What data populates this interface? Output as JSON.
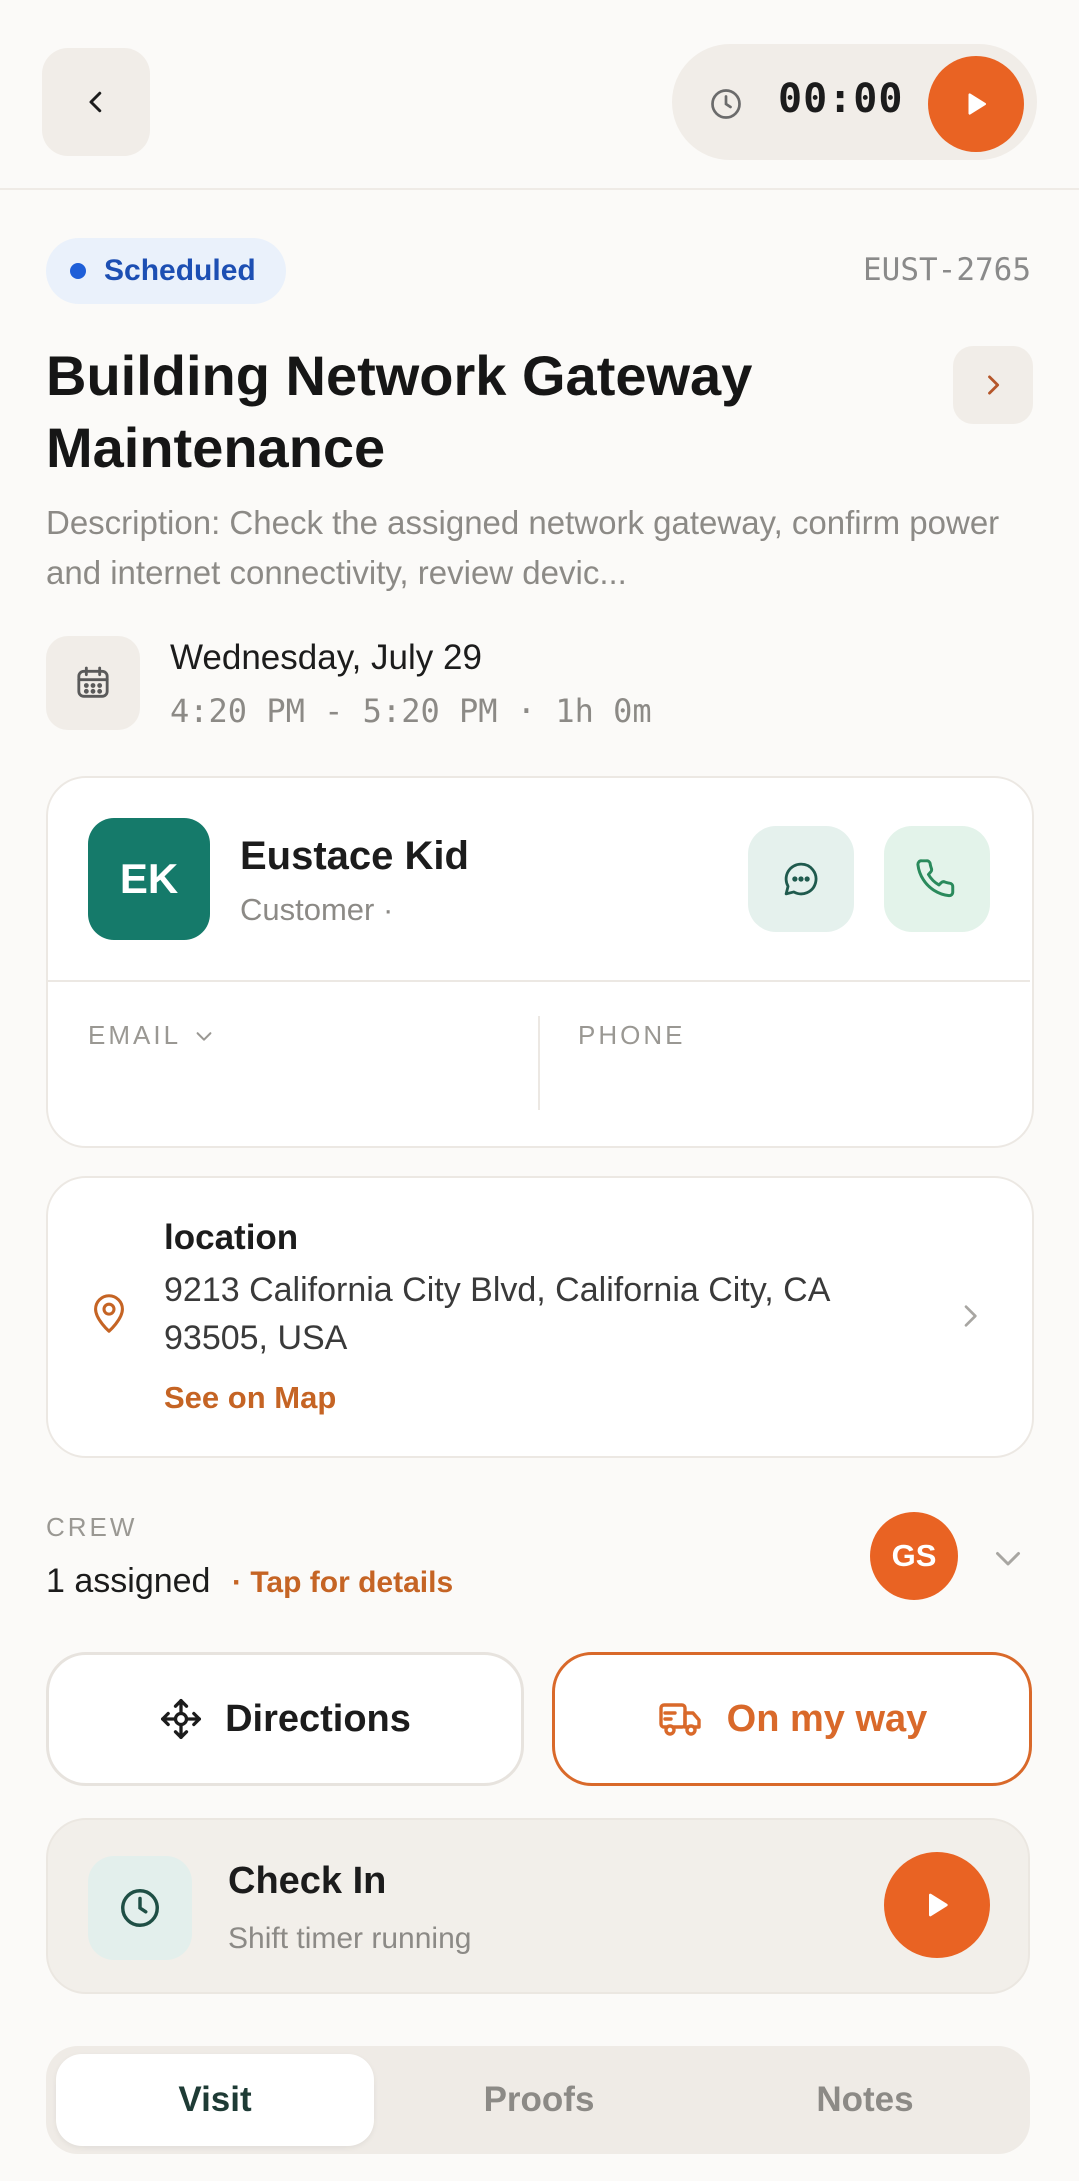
{
  "header": {
    "timer_value": "00:00"
  },
  "job": {
    "status": "Scheduled",
    "ticket_id": "EUST-2765",
    "title": "Building Network Gateway Maintenance",
    "description": "Description: Check the assigned network gateway, confirm power and internet connectivity, review devic...",
    "date": "Wednesday, July 29",
    "time_range": "4:20 PM - 5:20 PM · 1h 0m"
  },
  "contact": {
    "initials": "EK",
    "name": "Eustace Kid",
    "role": "Customer ·",
    "email_label": "EMAIL",
    "phone_label": "PHONE"
  },
  "location": {
    "title": "location",
    "address": "9213 California City Blvd, California City, CA 93505, USA",
    "map_link": "See on Map"
  },
  "crew": {
    "label": "CREW",
    "count": "1 assigned",
    "tap_text": "· Tap for details",
    "member_initials": "GS"
  },
  "actions": {
    "directions": "Directions",
    "on_my_way": "On my way"
  },
  "checkin": {
    "title": "Check In",
    "subtitle": "Shift timer running"
  },
  "tabs": [
    {
      "label": "Visit",
      "active": true
    },
    {
      "label": "Proofs",
      "active": false
    },
    {
      "label": "Notes",
      "active": false
    }
  ],
  "colors": {
    "accent": "#e96323",
    "status_blue": "#1f5fd8",
    "avatar_teal": "#157a6a",
    "link_orange": "#c56424"
  },
  "icons": {
    "back": "chevron-left-icon",
    "timer": "clock-icon",
    "play": "play-icon",
    "calendar": "calendar-icon",
    "message": "chat-icon",
    "phone": "phone-icon",
    "location": "map-pin-icon",
    "directions": "move-icon",
    "on_my_way": "truck-icon"
  }
}
